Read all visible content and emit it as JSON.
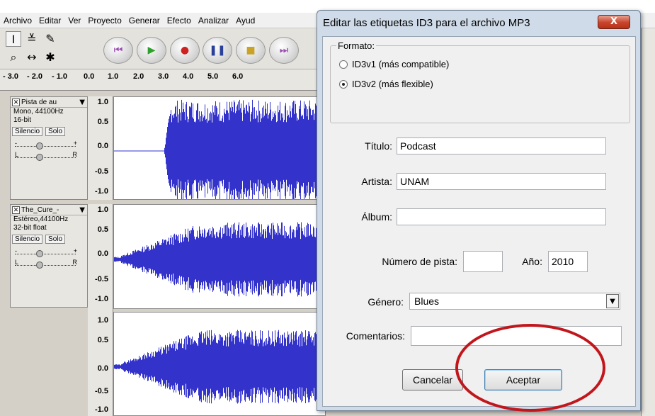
{
  "menubar": {
    "items": [
      "Archivo",
      "Editar",
      "Ver",
      "Proyecto",
      "Generar",
      "Efecto",
      "Analizar",
      "Ayud"
    ]
  },
  "ruler": {
    "labels": [
      "- 3.0",
      "- 2.0",
      "- 1.0",
      "0.0",
      "1.0",
      "2.0",
      "3.0",
      "4.0",
      "5.0",
      "6.0"
    ]
  },
  "tracks": [
    {
      "name": "Pista de au",
      "info1": "Mono, 44100Hz",
      "info2": "16-bit",
      "mute": "Silencio",
      "solo": "Solo",
      "scale": [
        "1.0",
        "0.5",
        "0.0",
        "-0.5",
        "-1.0"
      ]
    },
    {
      "name": "The_Cure_-",
      "info1": "Estéreo,44100Hz",
      "info2": "32-bit float",
      "mute": "Silencio",
      "solo": "Solo",
      "scale": [
        "1.0",
        "0.5",
        "0.0",
        "-0.5",
        "-1.0"
      ],
      "scale2": [
        "1.0",
        "0.5",
        "0.0",
        "-0.5",
        "-1.0"
      ]
    }
  ],
  "gain_slider": {
    "minus": "-",
    "plus": "+"
  },
  "pan_slider": {
    "left": "L",
    "right": "R"
  },
  "dialog": {
    "title": "Editar las etiquetas ID3 para el archivo MP3",
    "close": "X",
    "format": {
      "legend": "Formato:",
      "options": [
        {
          "label": "ID3v1 (más compatible)",
          "checked": false
        },
        {
          "label": "ID3v2 (más flexible)",
          "checked": true
        }
      ]
    },
    "fields": {
      "title_label": "Título:",
      "title_value": "Podcast",
      "artist_label": "Artista:",
      "artist_value": "UNAM",
      "album_label": "Álbum:",
      "album_value": "",
      "track_label": "Número de pista:",
      "track_value": "",
      "year_label": "Año:",
      "year_value": "2010",
      "genre_label": "Género:",
      "genre_value": "Blues",
      "comments_label": "Comentarios:",
      "comments_value": ""
    },
    "buttons": {
      "cancel": "Cancelar",
      "accept": "Aceptar"
    }
  },
  "colors": {
    "waveform": "#3333cc",
    "highlight": "#c0161c",
    "dialog_frame": "#cfdbe8"
  }
}
